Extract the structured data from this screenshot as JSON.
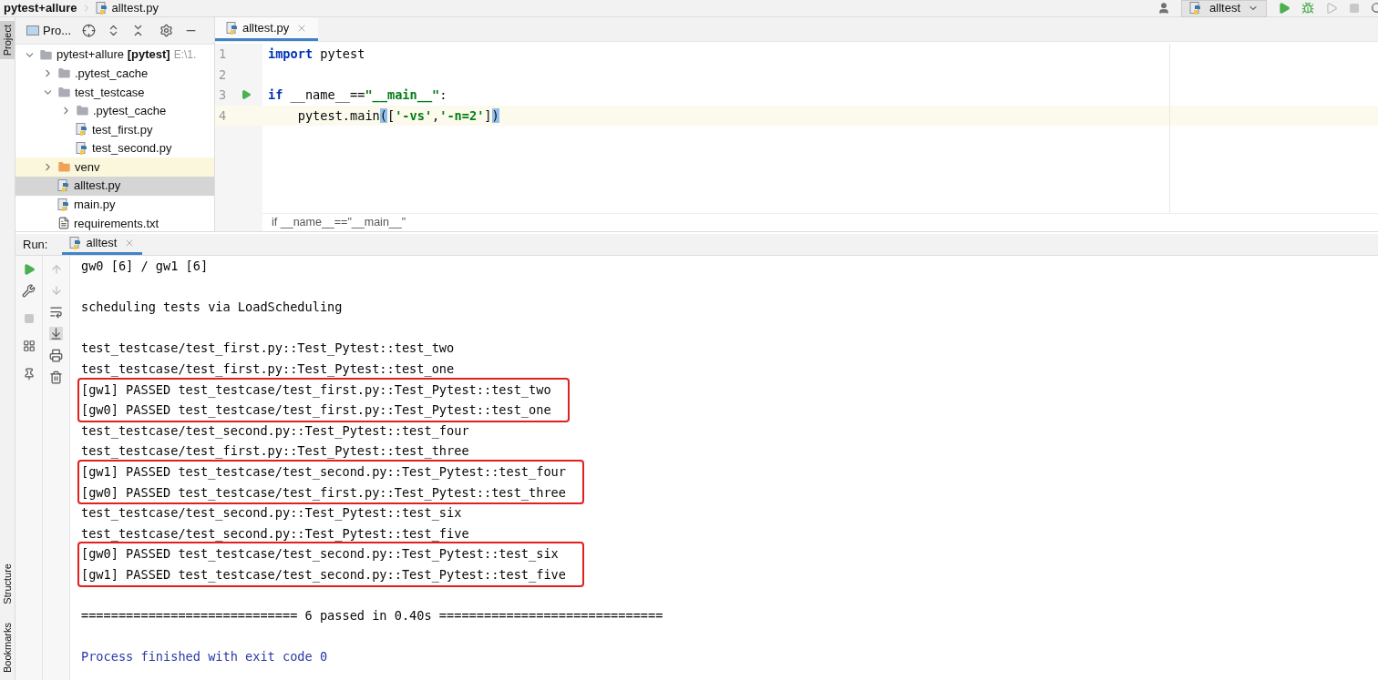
{
  "breadcrumb": [
    {
      "text": "pytest+allure",
      "kind": "project"
    },
    {
      "text": "alltest.py",
      "kind": "file"
    }
  ],
  "run_config": {
    "label": "alltest"
  },
  "left_strip": {
    "top": [
      {
        "label": "Project",
        "selected": true
      }
    ],
    "bottom": [
      {
        "label": "Structure",
        "selected": false
      },
      {
        "label": "Bookmarks",
        "selected": false
      }
    ]
  },
  "project_panel": {
    "title": "Pro...",
    "tree": [
      {
        "label": "pytest+allure **[pytest]**",
        "path": "E:\\1.",
        "kind": "folder",
        "expanded": true,
        "selected": false,
        "excluded": false,
        "children": [
          {
            "label": ".pytest_cache",
            "kind": "folder",
            "expanded": false,
            "selected": false,
            "excluded": false
          },
          {
            "label": "test_testcase",
            "kind": "folder",
            "expanded": true,
            "selected": false,
            "excluded": false,
            "children": [
              {
                "label": ".pytest_cache",
                "kind": "folder",
                "expanded": false,
                "selected": false,
                "excluded": false
              },
              {
                "label": "test_first.py",
                "kind": "python",
                "selected": false
              },
              {
                "label": "test_second.py",
                "kind": "python",
                "selected": false
              }
            ]
          },
          {
            "label": "venv",
            "kind": "folder",
            "expanded": false,
            "selected": false,
            "excluded": true
          },
          {
            "label": "alltest.py",
            "kind": "python",
            "selected": true
          },
          {
            "label": "main.py",
            "kind": "python",
            "selected": false
          },
          {
            "label": "requirements.txt",
            "kind": "text",
            "selected": false
          }
        ]
      }
    ]
  },
  "editor": {
    "tabs": [
      {
        "label": "alltest.py",
        "selected": true
      }
    ],
    "lines": [
      {
        "number": "1",
        "runnable": false,
        "current": false,
        "tokens": [
          {
            "text": "import",
            "kind": "keyword"
          },
          {
            "text": " pytest",
            "kind": "plain"
          }
        ]
      },
      {
        "number": "2",
        "runnable": false,
        "current": false
      },
      {
        "number": "3",
        "runnable": true,
        "current": false,
        "tokens": [
          {
            "text": "if",
            "kind": "keyword"
          },
          {
            "text": " __name__==",
            "kind": "plain"
          },
          {
            "text": "\"__main__\"",
            "kind": "string"
          },
          {
            "text": ":",
            "kind": "plain"
          }
        ]
      },
      {
        "number": "4",
        "runnable": false,
        "current": true,
        "tokens": [
          {
            "text": "    pytest.main",
            "kind": "plain"
          },
          {
            "text": "(",
            "kind": "brace"
          },
          {
            "text": "[",
            "kind": "plain"
          },
          {
            "text": "'-vs'",
            "kind": "string"
          },
          {
            "text": ",",
            "kind": "plain"
          },
          {
            "text": "'-n=2'",
            "kind": "string"
          },
          {
            "text": "]",
            "kind": "plain"
          },
          {
            "text": ")",
            "kind": "brace"
          }
        ]
      }
    ],
    "breadcrumb": "if __name__==\"__main__\""
  },
  "run_panel": {
    "label": "Run:",
    "tabs": [
      {
        "label": "alltest",
        "selected": true
      }
    ],
    "console": [
      {
        "kind": "text",
        "lines": [
          "gw0 [6] / gw1 [6]"
        ]
      },
      {
        "kind": "blank"
      },
      {
        "kind": "text",
        "lines": [
          "scheduling tests via LoadScheduling"
        ]
      },
      {
        "kind": "blank"
      },
      {
        "kind": "text",
        "lines": [
          "test_testcase/test_first.py::Test_Pytest::test_two",
          "test_testcase/test_first.py::Test_Pytest::test_one"
        ]
      },
      {
        "kind": "boxed",
        "lines": [
          "[gw1] PASSED test_testcase/test_first.py::Test_Pytest::test_two",
          "[gw0] PASSED test_testcase/test_first.py::Test_Pytest::test_one"
        ]
      },
      {
        "kind": "text",
        "lines": [
          "test_testcase/test_second.py::Test_Pytest::test_four",
          "test_testcase/test_first.py::Test_Pytest::test_three"
        ]
      },
      {
        "kind": "boxed",
        "lines": [
          "[gw1] PASSED test_testcase/test_second.py::Test_Pytest::test_four",
          "[gw0] PASSED test_testcase/test_first.py::Test_Pytest::test_three"
        ]
      },
      {
        "kind": "text",
        "lines": [
          "test_testcase/test_second.py::Test_Pytest::test_six",
          "test_testcase/test_second.py::Test_Pytest::test_five"
        ]
      },
      {
        "kind": "boxed",
        "lines": [
          "[gw0] PASSED test_testcase/test_second.py::Test_Pytest::test_six",
          "[gw1] PASSED test_testcase/test_second.py::Test_Pytest::test_five"
        ]
      },
      {
        "kind": "blank"
      },
      {
        "kind": "text",
        "lines": [
          "============================= 6 passed in 0.40s =============================="
        ]
      },
      {
        "kind": "blank"
      },
      {
        "kind": "status",
        "lines": [
          "Process finished with exit code 0"
        ]
      }
    ]
  }
}
